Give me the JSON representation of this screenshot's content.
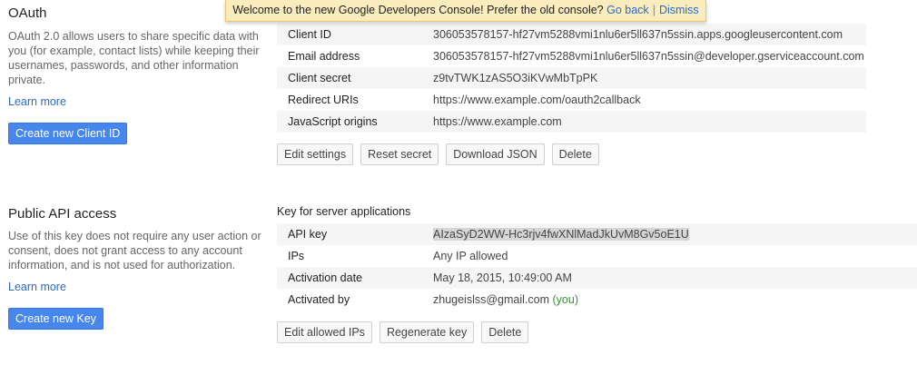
{
  "banner": {
    "message": "Welcome to the new Google Developers Console! Prefer the old console?",
    "go_back": "Go back",
    "separator": "|",
    "dismiss": "Dismiss"
  },
  "oauth": {
    "title": "OAuth",
    "description": "OAuth 2.0 allows users to share specific data with you (for example, contact lists) while keeping their usernames, passwords, and other information private.",
    "learn_more": "Learn more",
    "create_button": "Create new Client ID",
    "rows": [
      {
        "label": "Client ID",
        "value": "306053578157-hf27vm5288vmi1nlu6er5ll637n5ssin.apps.googleusercontent.com"
      },
      {
        "label": "Email address",
        "value": "306053578157-hf27vm5288vmi1nlu6er5ll637n5ssin@developer.gserviceaccount.com"
      },
      {
        "label": "Client secret",
        "value": "z9tvTWK1zAS5O3iKVwMbTpPK"
      },
      {
        "label": "Redirect URIs",
        "value": "https://www.example.com/oauth2callback"
      },
      {
        "label": "JavaScript origins",
        "value": "https://www.example.com"
      }
    ],
    "buttons": {
      "edit_settings": "Edit settings",
      "reset_secret": "Reset secret",
      "download_json": "Download JSON",
      "delete": "Delete"
    }
  },
  "public_api": {
    "title": "Public API access",
    "description": "Use of this key does not require any user action or consent, does not grant access to any account information, and is not used for authorization.",
    "learn_more": "Learn more",
    "create_button": "Create new Key",
    "key_title": "Key for server applications",
    "rows": {
      "api_key": {
        "label": "API key",
        "value": "AIzaSyD2WW-Hc3rjv4fwXNlMadJkUvM8Gv5oE1U"
      },
      "ips": {
        "label": "IPs",
        "value": "Any IP allowed"
      },
      "activation_date": {
        "label": "Activation date",
        "value": "May 18, 2015, 10:49:00 AM"
      },
      "activated_by": {
        "label": "Activated by",
        "value": "zhugeislss@gmail.com",
        "suffix": "(you)"
      }
    },
    "buttons": {
      "edit_allowed_ips": "Edit allowed IPs",
      "regenerate_key": "Regenerate key",
      "delete": "Delete"
    }
  },
  "colors": {
    "primary_button": "#4787ed",
    "link": "#2a6ac8",
    "banner_bg": "#f9edbe",
    "you_text": "#3b8e3b"
  }
}
